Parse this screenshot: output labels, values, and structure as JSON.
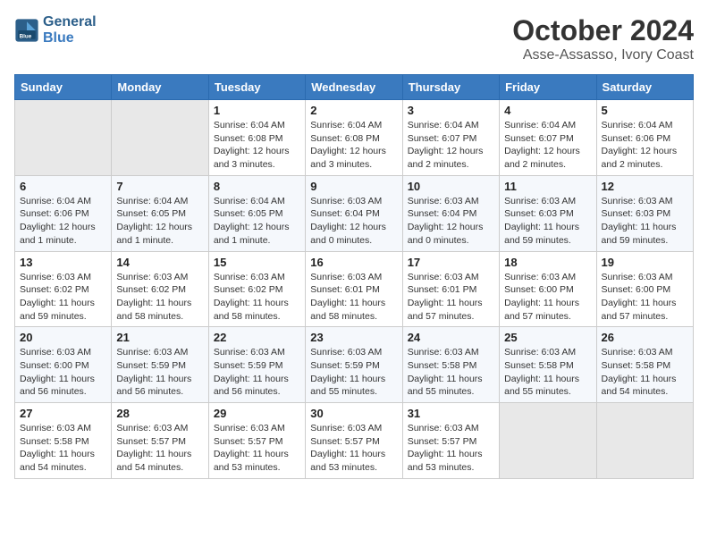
{
  "logo": {
    "text_general": "General",
    "text_blue": "Blue"
  },
  "title": "October 2024",
  "subtitle": "Asse-Assasso, Ivory Coast",
  "weekdays": [
    "Sunday",
    "Monday",
    "Tuesday",
    "Wednesday",
    "Thursday",
    "Friday",
    "Saturday"
  ],
  "weeks": [
    [
      {
        "day": "",
        "empty": true
      },
      {
        "day": "",
        "empty": true
      },
      {
        "day": "1",
        "sunrise": "Sunrise: 6:04 AM",
        "sunset": "Sunset: 6:08 PM",
        "daylight": "Daylight: 12 hours and 3 minutes."
      },
      {
        "day": "2",
        "sunrise": "Sunrise: 6:04 AM",
        "sunset": "Sunset: 6:08 PM",
        "daylight": "Daylight: 12 hours and 3 minutes."
      },
      {
        "day": "3",
        "sunrise": "Sunrise: 6:04 AM",
        "sunset": "Sunset: 6:07 PM",
        "daylight": "Daylight: 12 hours and 2 minutes."
      },
      {
        "day": "4",
        "sunrise": "Sunrise: 6:04 AM",
        "sunset": "Sunset: 6:07 PM",
        "daylight": "Daylight: 12 hours and 2 minutes."
      },
      {
        "day": "5",
        "sunrise": "Sunrise: 6:04 AM",
        "sunset": "Sunset: 6:06 PM",
        "daylight": "Daylight: 12 hours and 2 minutes."
      }
    ],
    [
      {
        "day": "6",
        "sunrise": "Sunrise: 6:04 AM",
        "sunset": "Sunset: 6:06 PM",
        "daylight": "Daylight: 12 hours and 1 minute."
      },
      {
        "day": "7",
        "sunrise": "Sunrise: 6:04 AM",
        "sunset": "Sunset: 6:05 PM",
        "daylight": "Daylight: 12 hours and 1 minute."
      },
      {
        "day": "8",
        "sunrise": "Sunrise: 6:04 AM",
        "sunset": "Sunset: 6:05 PM",
        "daylight": "Daylight: 12 hours and 1 minute."
      },
      {
        "day": "9",
        "sunrise": "Sunrise: 6:03 AM",
        "sunset": "Sunset: 6:04 PM",
        "daylight": "Daylight: 12 hours and 0 minutes."
      },
      {
        "day": "10",
        "sunrise": "Sunrise: 6:03 AM",
        "sunset": "Sunset: 6:04 PM",
        "daylight": "Daylight: 12 hours and 0 minutes."
      },
      {
        "day": "11",
        "sunrise": "Sunrise: 6:03 AM",
        "sunset": "Sunset: 6:03 PM",
        "daylight": "Daylight: 11 hours and 59 minutes."
      },
      {
        "day": "12",
        "sunrise": "Sunrise: 6:03 AM",
        "sunset": "Sunset: 6:03 PM",
        "daylight": "Daylight: 11 hours and 59 minutes."
      }
    ],
    [
      {
        "day": "13",
        "sunrise": "Sunrise: 6:03 AM",
        "sunset": "Sunset: 6:02 PM",
        "daylight": "Daylight: 11 hours and 59 minutes."
      },
      {
        "day": "14",
        "sunrise": "Sunrise: 6:03 AM",
        "sunset": "Sunset: 6:02 PM",
        "daylight": "Daylight: 11 hours and 58 minutes."
      },
      {
        "day": "15",
        "sunrise": "Sunrise: 6:03 AM",
        "sunset": "Sunset: 6:02 PM",
        "daylight": "Daylight: 11 hours and 58 minutes."
      },
      {
        "day": "16",
        "sunrise": "Sunrise: 6:03 AM",
        "sunset": "Sunset: 6:01 PM",
        "daylight": "Daylight: 11 hours and 58 minutes."
      },
      {
        "day": "17",
        "sunrise": "Sunrise: 6:03 AM",
        "sunset": "Sunset: 6:01 PM",
        "daylight": "Daylight: 11 hours and 57 minutes."
      },
      {
        "day": "18",
        "sunrise": "Sunrise: 6:03 AM",
        "sunset": "Sunset: 6:00 PM",
        "daylight": "Daylight: 11 hours and 57 minutes."
      },
      {
        "day": "19",
        "sunrise": "Sunrise: 6:03 AM",
        "sunset": "Sunset: 6:00 PM",
        "daylight": "Daylight: 11 hours and 57 minutes."
      }
    ],
    [
      {
        "day": "20",
        "sunrise": "Sunrise: 6:03 AM",
        "sunset": "Sunset: 6:00 PM",
        "daylight": "Daylight: 11 hours and 56 minutes."
      },
      {
        "day": "21",
        "sunrise": "Sunrise: 6:03 AM",
        "sunset": "Sunset: 5:59 PM",
        "daylight": "Daylight: 11 hours and 56 minutes."
      },
      {
        "day": "22",
        "sunrise": "Sunrise: 6:03 AM",
        "sunset": "Sunset: 5:59 PM",
        "daylight": "Daylight: 11 hours and 56 minutes."
      },
      {
        "day": "23",
        "sunrise": "Sunrise: 6:03 AM",
        "sunset": "Sunset: 5:59 PM",
        "daylight": "Daylight: 11 hours and 55 minutes."
      },
      {
        "day": "24",
        "sunrise": "Sunrise: 6:03 AM",
        "sunset": "Sunset: 5:58 PM",
        "daylight": "Daylight: 11 hours and 55 minutes."
      },
      {
        "day": "25",
        "sunrise": "Sunrise: 6:03 AM",
        "sunset": "Sunset: 5:58 PM",
        "daylight": "Daylight: 11 hours and 55 minutes."
      },
      {
        "day": "26",
        "sunrise": "Sunrise: 6:03 AM",
        "sunset": "Sunset: 5:58 PM",
        "daylight": "Daylight: 11 hours and 54 minutes."
      }
    ],
    [
      {
        "day": "27",
        "sunrise": "Sunrise: 6:03 AM",
        "sunset": "Sunset: 5:58 PM",
        "daylight": "Daylight: 11 hours and 54 minutes."
      },
      {
        "day": "28",
        "sunrise": "Sunrise: 6:03 AM",
        "sunset": "Sunset: 5:57 PM",
        "daylight": "Daylight: 11 hours and 54 minutes."
      },
      {
        "day": "29",
        "sunrise": "Sunrise: 6:03 AM",
        "sunset": "Sunset: 5:57 PM",
        "daylight": "Daylight: 11 hours and 53 minutes."
      },
      {
        "day": "30",
        "sunrise": "Sunrise: 6:03 AM",
        "sunset": "Sunset: 5:57 PM",
        "daylight": "Daylight: 11 hours and 53 minutes."
      },
      {
        "day": "31",
        "sunrise": "Sunrise: 6:03 AM",
        "sunset": "Sunset: 5:57 PM",
        "daylight": "Daylight: 11 hours and 53 minutes."
      },
      {
        "day": "",
        "empty": true
      },
      {
        "day": "",
        "empty": true
      }
    ]
  ]
}
